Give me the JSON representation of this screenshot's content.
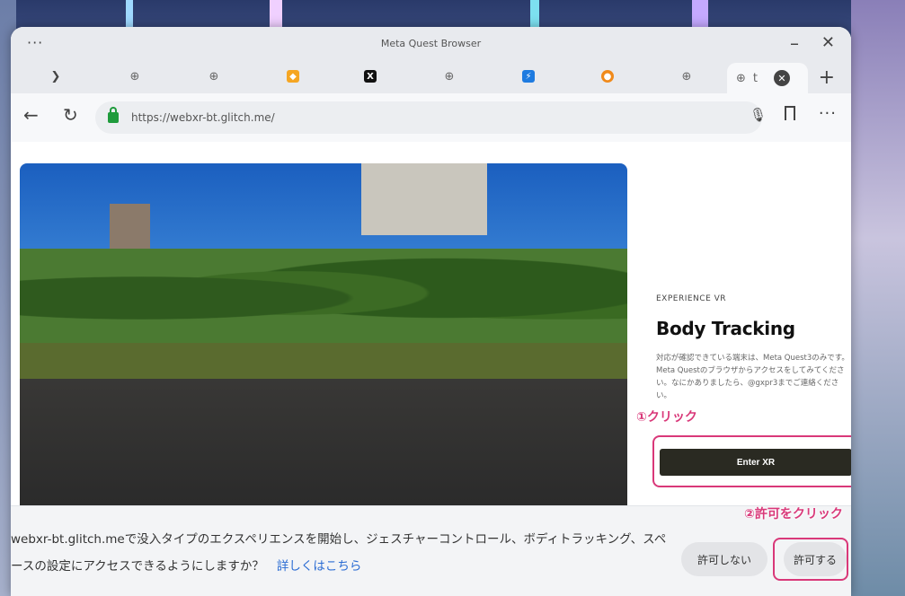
{
  "window": {
    "title": "Meta Quest Browser",
    "menu_icon": "more-horizontal-icon",
    "minimize_glyph": "–",
    "close_glyph": "✕"
  },
  "tabs": [
    {
      "icon": "bird-favicon",
      "color": "#444444",
      "glyph": "❯"
    },
    {
      "icon": "globe-icon",
      "color": "#666666",
      "glyph": "⊕"
    },
    {
      "icon": "globe-icon",
      "color": "#666666",
      "glyph": "⊕"
    },
    {
      "icon": "orange-favicon",
      "color": "#f5a623",
      "glyph": "◆"
    },
    {
      "icon": "x-logo-favicon",
      "color": "#111111",
      "glyph": "X"
    },
    {
      "icon": "globe-icon",
      "color": "#666666",
      "glyph": "⊕"
    },
    {
      "icon": "lightning-favicon",
      "color": "#1e7be0",
      "glyph": "⚡"
    },
    {
      "icon": "orange-circle-favicon",
      "color": "#f08a1b",
      "glyph": "●"
    },
    {
      "icon": "globe-icon",
      "color": "#666666",
      "glyph": "⊕"
    }
  ],
  "active_tab": {
    "icon": "globe-icon",
    "glyph": "⊕",
    "partial_text": "t",
    "close_glyph": "✕"
  },
  "newtab_glyph": "+",
  "address": {
    "url": "https://webxr-bt.glitch.me/",
    "back_glyph": "←",
    "reload_glyph": "↻",
    "mic_glyph": "🎤",
    "more_glyph": "···"
  },
  "page": {
    "eyebrow": "EXPERIENCE VR",
    "heading": "Body Tracking",
    "description": "対応が確認できている端末は、Meta Quest3のみです。Meta Questのブラウザからアクセスをしてみてください。なにかありましたら、@gxpr3までご連絡ください。",
    "enter_button": "Enter XR"
  },
  "annotations": {
    "step1": "①クリック",
    "step2": "②許可をクリック",
    "accent_color": "#d93879"
  },
  "permission": {
    "text": "webxr-bt.glitch.meで没入タイプのエクスペリエンスを開始し、ジェスチャーコントロール、ボディトラッキング、スペースの設定にアクセスできるようにしますか？",
    "link": "詳しくはこちら",
    "deny": "許可しない",
    "allow": "許可する"
  }
}
